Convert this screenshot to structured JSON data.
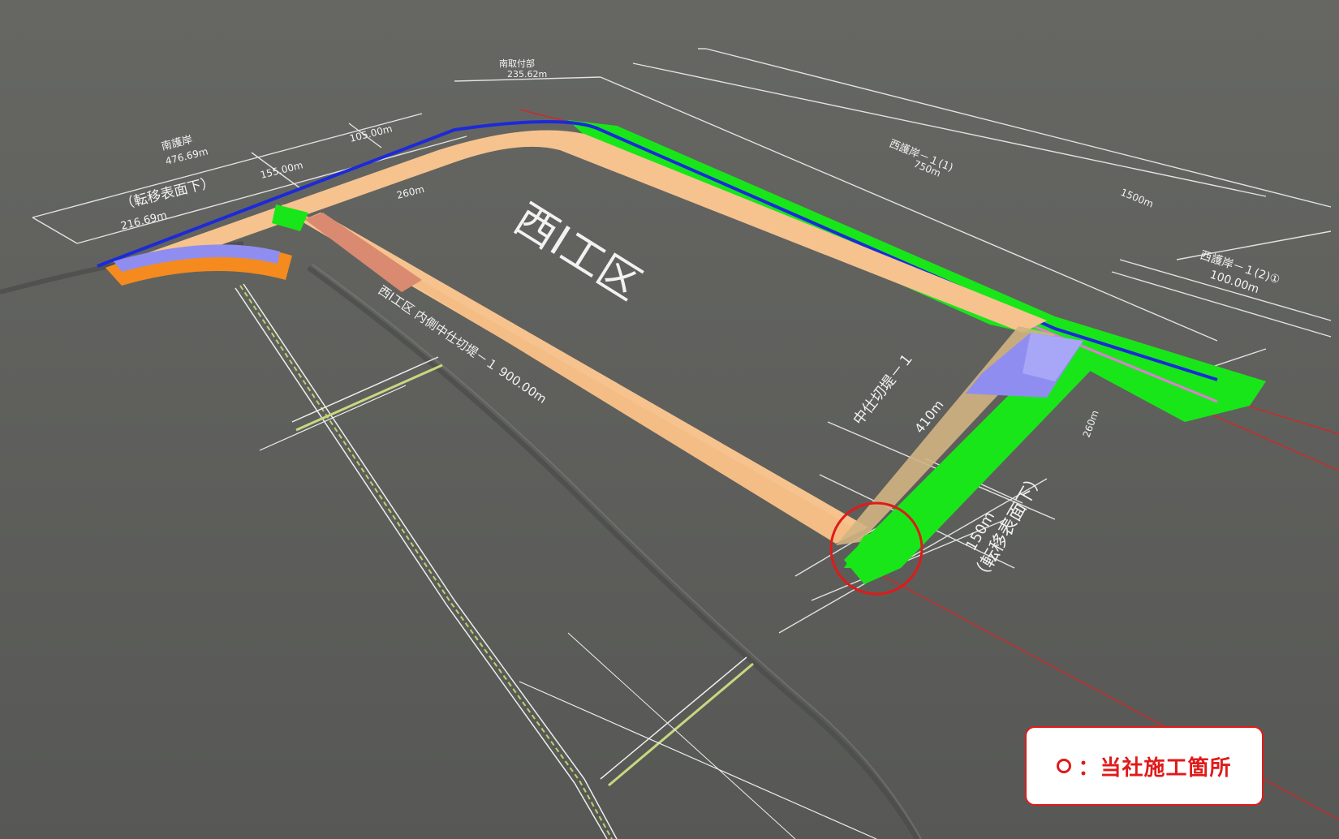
{
  "labels": {
    "main_area": "西Ⅰ工区",
    "south_revetment": "南護岸",
    "south_revetment_len": "476.69m",
    "transfer_top": "（転移表面下）",
    "len_216": "216.69m",
    "len_155": "155.00m",
    "len_105": "105.00m",
    "len_260_top": "260m",
    "north_attach": "南取付部",
    "north_attach_len": "235.62m",
    "west_rev_1_1": "西護岸－１(1)",
    "len_750": "750m",
    "len_1500": "1500m",
    "west_rev_1_2": "西護岸－１(2)①",
    "len_100": "100.00m",
    "inner_dike": "西Ⅰ工区 内側中仕切堤－１ 900.00m",
    "mid_dike": "中仕切堤－１",
    "len_410": "410m",
    "len_260_right": "260m",
    "len_150": "150m",
    "transfer_bottom": "（転移表面下）"
  },
  "legend": {
    "text": "：当社施工箇所"
  },
  "colors": {
    "ground": "#5c5d5a",
    "dike": "#f6c38f",
    "green": "#19e619",
    "blue": "#1c2ad8",
    "orange": "#f58a1e",
    "purple": "#8f8ef0",
    "salmon": "#d98a70",
    "highlight": "#e01a1a"
  }
}
